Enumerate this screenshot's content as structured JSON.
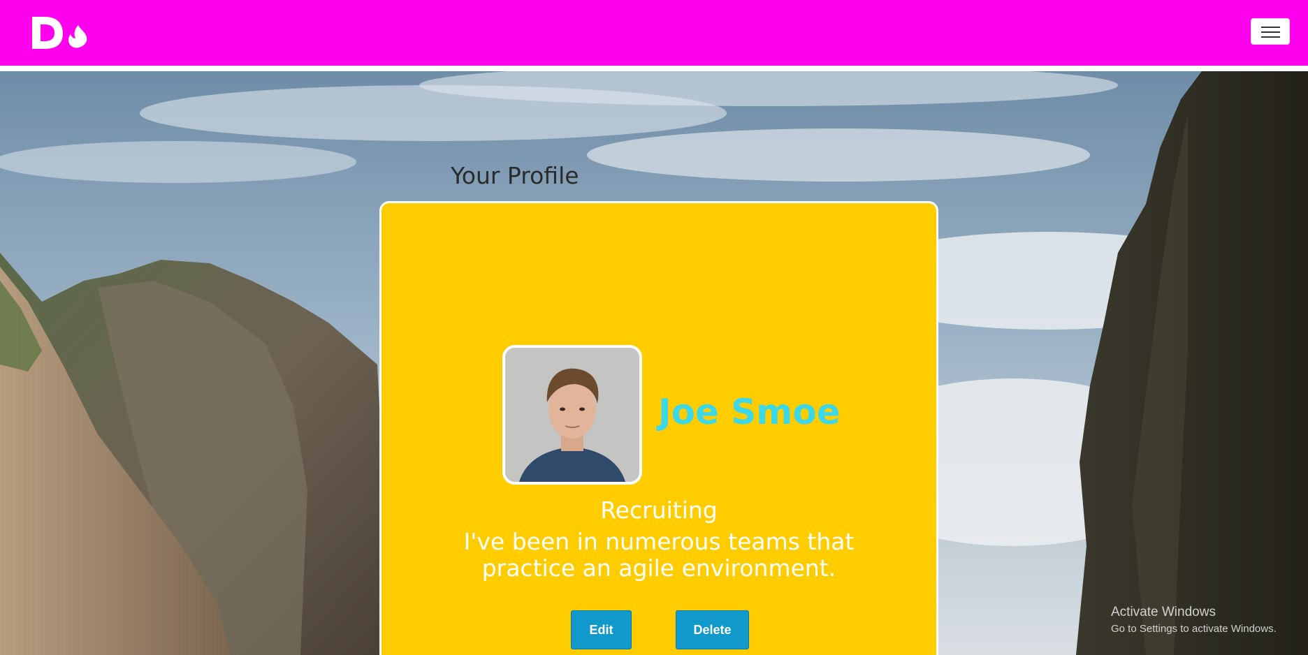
{
  "navbar": {
    "logo": "Do",
    "logo_icon": "flame-icon",
    "menu_icon": "hamburger-icon",
    "background_color": "#ff00ee"
  },
  "profile": {
    "heading": "Your Profile",
    "name": "Joe Smoe",
    "role": "Recruiting",
    "bio": "I've been in numerous teams that practice an agile environment.",
    "card_color": "#ffcc00",
    "name_color": "#3dd8e8",
    "edit_label": "Edit",
    "delete_label": "Delete",
    "button_color": "#1199cc"
  },
  "watermark": {
    "title": "Activate Windows",
    "subtitle": "Go to Settings to activate Windows."
  }
}
